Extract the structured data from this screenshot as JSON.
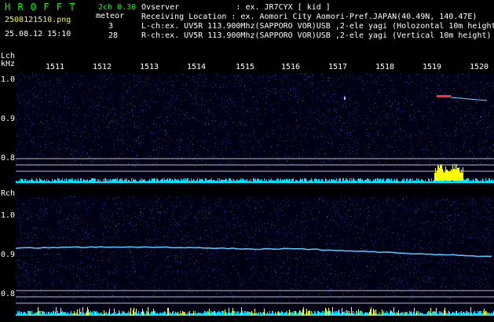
{
  "header": {
    "brand": "H R O F F T",
    "version": "2ch 0.30",
    "filename": "2508121510.png",
    "meteor_label": "meteor",
    "meteor_l": "3",
    "meteor_r": "28",
    "datetime": "25.08.12 15:10",
    "observer": "Ovserver            : ex. JR7CYX [ kid ]",
    "location": "Receiving Location : ex. Aomori City Aomori-Pref.JAPAN(40.49N, 140.47E)",
    "lch_line": "L-ch:ex. UV5R 113.900Mhz(SAPPORO VOR)USB ,2-ele yagi (Holozontal 10m height)",
    "rch_line": "R-ch:ex. UV5R 113.900Mhz(SAPPORO VOR)USB ,2-ele yagi (Vertical 10m height)"
  },
  "lch": {
    "label": "Lch",
    "unit": "kHz",
    "y_ticks": [
      "1.0",
      "0.9",
      "0.8"
    ]
  },
  "rch": {
    "label": "Rch",
    "y_ticks": [
      "1.0",
      "0.9",
      "0.8"
    ]
  },
  "time_ticks": [
    "1511",
    "1512",
    "1513",
    "1514",
    "1515",
    "1516",
    "1517",
    "1518",
    "1519",
    "1520"
  ],
  "colors": {
    "background": "#000000",
    "noise": "#1a2a8a",
    "trace": "#55ccff",
    "baseline": "#00e5ff",
    "meteor_burst": "#ffff00",
    "header_green": "#00ff00",
    "header_yellow": "#ffff00"
  }
}
